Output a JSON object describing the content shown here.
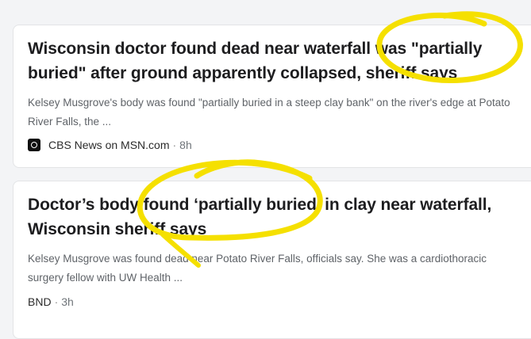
{
  "articles": [
    {
      "headline": "Wisconsin doctor found dead near waterfall was \"partially buried\" after ground apparently collapsed, sheriff says",
      "snippet": "Kelsey Musgrove's body was found \"partially buried in a steep clay bank\" on the river's edge at Potato River Falls, the ...",
      "source": "CBS News on MSN.com",
      "separator": "·",
      "time": "8h",
      "logo_icon": "cbs-eye-icon"
    },
    {
      "headline": "Doctor’s body found ‘partially buried’ in clay near waterfall, Wisconsin sheriff says",
      "snippet": "Kelsey Musgrove was found dead near Potato River Falls, officials say. She was a cardiothoracic surgery fellow with UW Health ...",
      "source": "BND",
      "separator": "·",
      "time": "3h"
    }
  ],
  "annotation_color": "#f5e000"
}
